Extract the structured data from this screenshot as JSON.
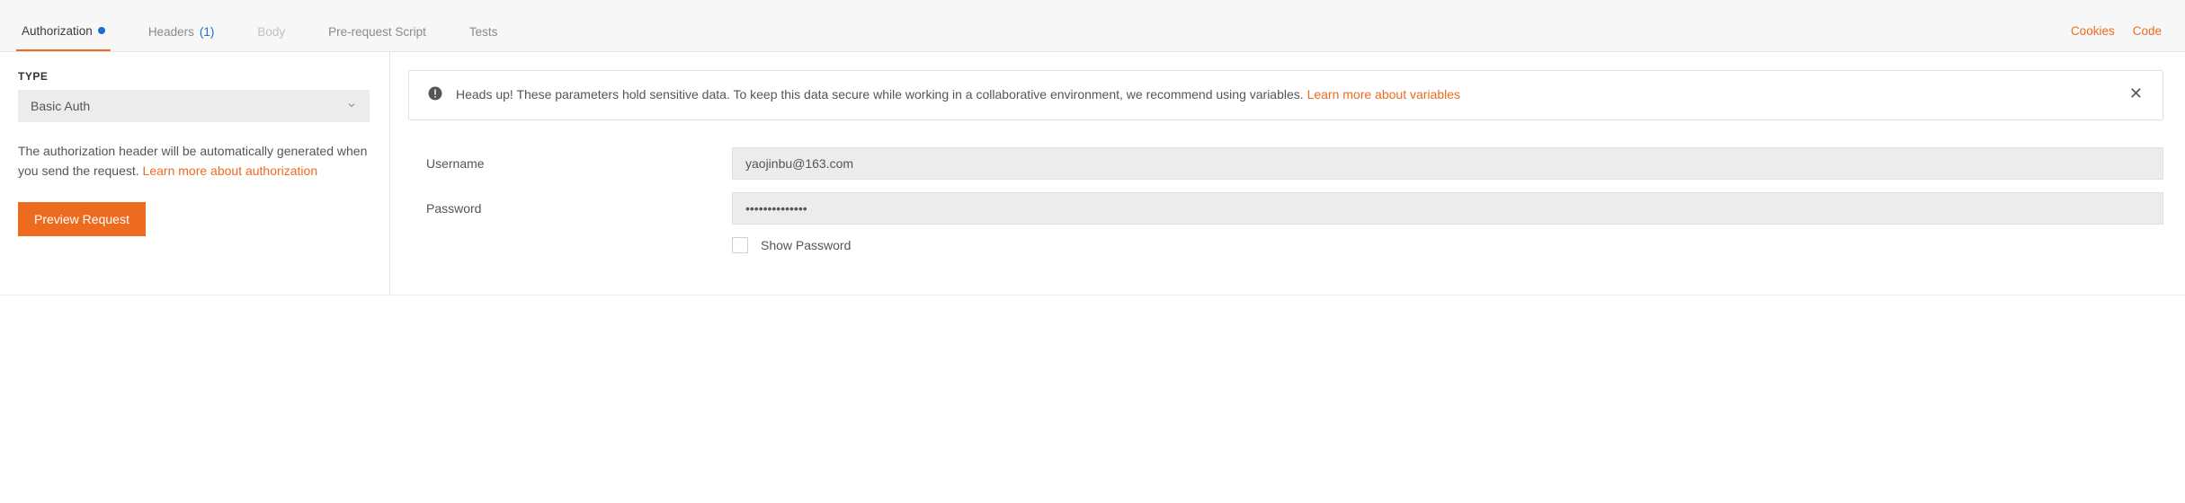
{
  "tabs": {
    "authorization": "Authorization",
    "headers": "Headers",
    "headers_count": "(1)",
    "body": "Body",
    "prerequest": "Pre-request Script",
    "tests": "Tests"
  },
  "right_links": {
    "cookies": "Cookies",
    "code": "Code"
  },
  "left": {
    "type_label": "TYPE",
    "type_value": "Basic Auth",
    "desc_1": "The authorization header will be automatically generated when you send the request. ",
    "desc_link": "Learn more about authorization",
    "preview_btn": "Preview Request"
  },
  "alert": {
    "heads": "Heads up!",
    "text": " These parameters hold sensitive data. To keep this data secure while working in a collaborative environment, we recommend using variables. ",
    "link": "Learn more about variables"
  },
  "form": {
    "username_label": "Username",
    "username_value": "yaojinbu@163.com",
    "password_label": "Password",
    "password_value": "••••••••••••••",
    "show_pw_label": "Show Password"
  }
}
